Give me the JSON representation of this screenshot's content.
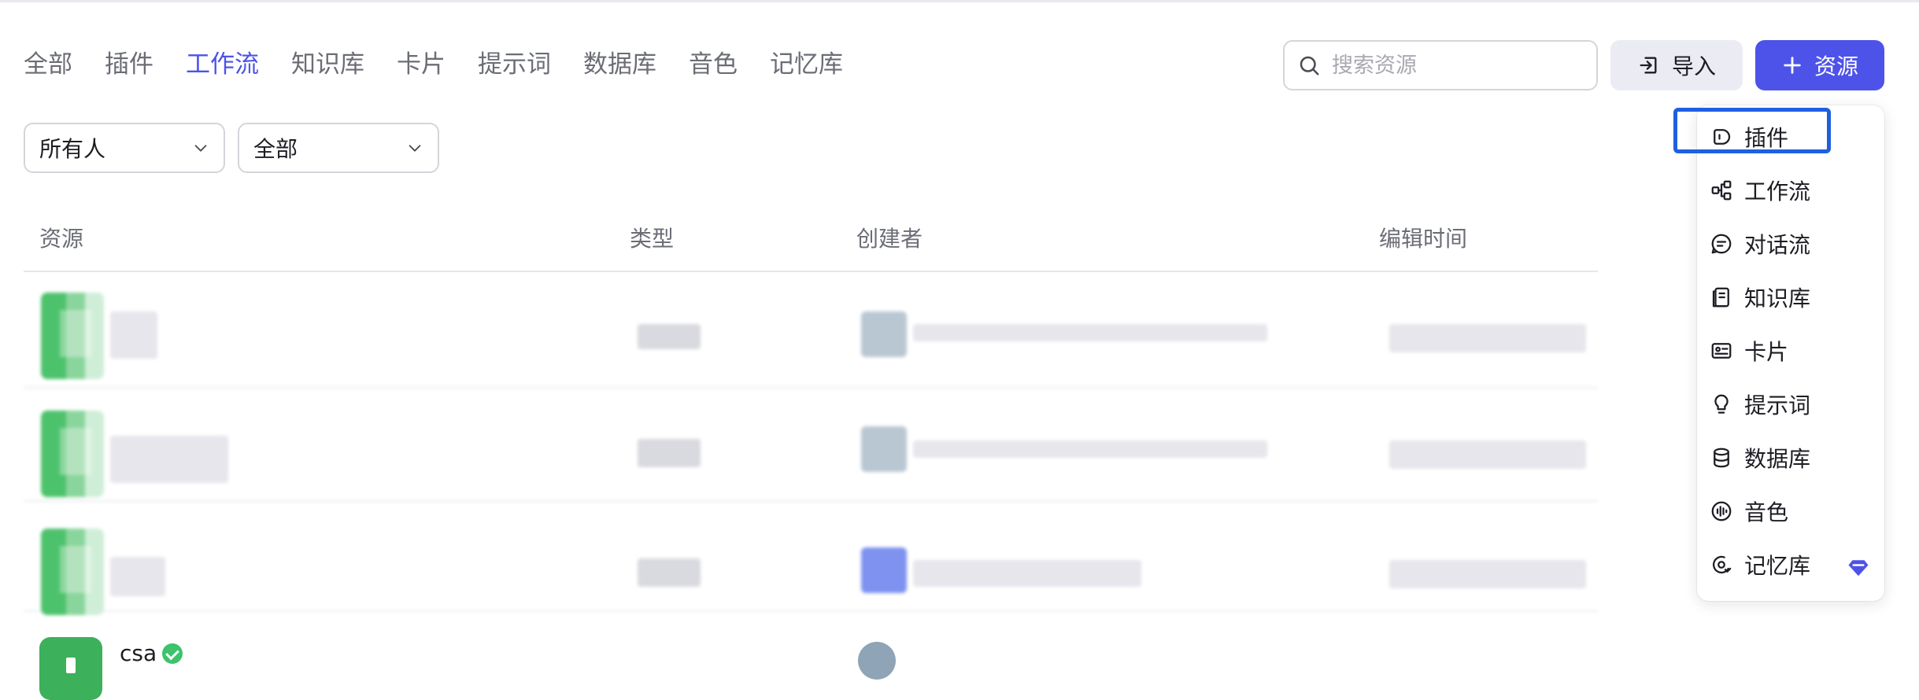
{
  "tabs": [
    "全部",
    "插件",
    "工作流",
    "知识库",
    "卡片",
    "提示词",
    "数据库",
    "音色",
    "记忆库"
  ],
  "active_tab": "工作流",
  "search": {
    "placeholder": "搜索资源"
  },
  "actions": {
    "import_label": "导入",
    "add_label": "资源"
  },
  "filters": {
    "owner": "所有人",
    "type": "全部"
  },
  "table": {
    "headers": {
      "resource": "资源",
      "type": "类型",
      "creator": "创建者",
      "edited": "编辑时间"
    },
    "last_row": {
      "name": "csa"
    }
  },
  "menu": {
    "items": [
      {
        "label": "插件",
        "icon": "plugin-icon"
      },
      {
        "label": "工作流",
        "icon": "workflow-icon"
      },
      {
        "label": "对话流",
        "icon": "chatflow-icon"
      },
      {
        "label": "知识库",
        "icon": "knowledge-icon"
      },
      {
        "label": "卡片",
        "icon": "card-icon"
      },
      {
        "label": "提示词",
        "icon": "prompt-icon"
      },
      {
        "label": "数据库",
        "icon": "database-icon"
      },
      {
        "label": "音色",
        "icon": "voice-icon"
      },
      {
        "label": "记忆库",
        "icon": "memory-icon"
      }
    ],
    "highlighted": "插件"
  },
  "colors": {
    "accent": "#4d53e8",
    "highlight_border": "#1f5fe0",
    "success": "#3cc36b"
  }
}
